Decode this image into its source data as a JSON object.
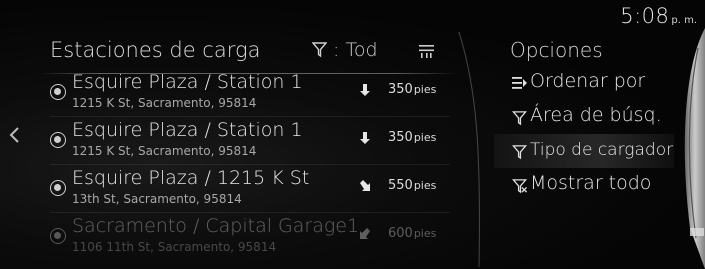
{
  "status": {
    "time": "5:08",
    "ampm": "p. m."
  },
  "list_panel": {
    "title": "Estaciones de carga",
    "filter_label": ": Tod",
    "icons": {
      "filter": "filter-icon",
      "sort": "sort-list-icon"
    },
    "stations": [
      {
        "name": "Esquire Plaza / Station 1",
        "address": "1215 K St, Sacramento, 95814",
        "distance": "350",
        "unit": "pies",
        "direction": "south"
      },
      {
        "name": "Esquire Plaza / Station 1",
        "address": "1215 K St, Sacramento, 95814",
        "distance": "350",
        "unit": "pies",
        "direction": "south"
      },
      {
        "name": "Esquire Plaza / 1215 K St",
        "address": "13th St, Sacramento, 95814",
        "distance": "550",
        "unit": "pies",
        "direction": "southeast"
      },
      {
        "name": "Sacramento / Capital Garage1",
        "address": "1106 11th St, Sacramento, 95814",
        "distance": "600",
        "unit": "pies",
        "direction": "southwest"
      }
    ]
  },
  "options_panel": {
    "title": "Opciones",
    "items": [
      {
        "label": "Ordenar por",
        "icon": "sort-icon"
      },
      {
        "label": "Área de búsq.",
        "icon": "filter-icon"
      },
      {
        "label": "Tipo de cargador",
        "icon": "filter-icon",
        "selected": true
      },
      {
        "label": "Mostrar todo",
        "icon": "filter-clear-icon"
      }
    ]
  },
  "colors": {
    "background": "#050505",
    "text": "#e8e8e8",
    "secondary_text": "#a8a8a8"
  }
}
